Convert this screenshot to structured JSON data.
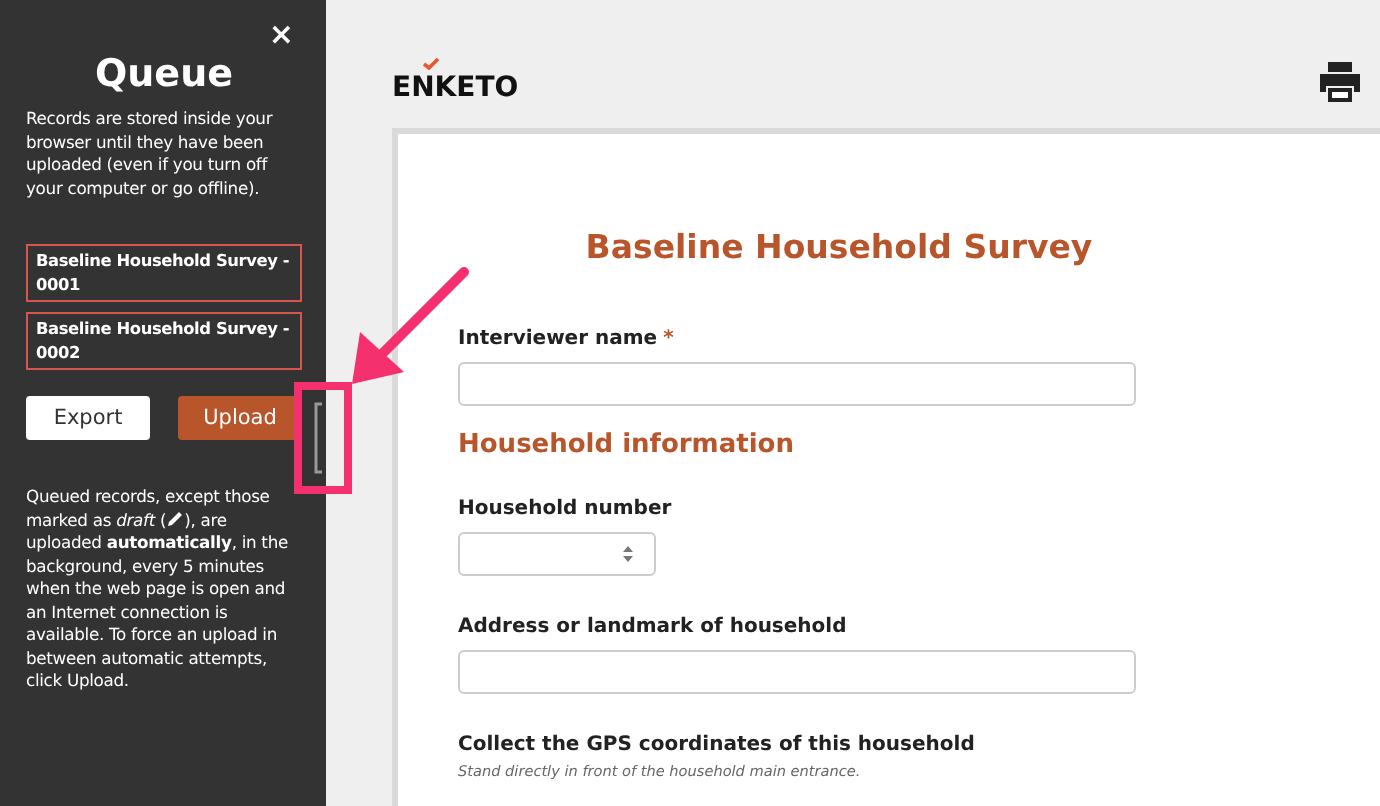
{
  "sidebar": {
    "close": "×",
    "title": "Queue",
    "intro": "Records are stored inside your browser until they have been uploaded (even if you turn off your computer or go offline).",
    "records": [
      "Baseline Household Survey - 0001",
      "Baseline Household Survey - 0002"
    ],
    "buttons": [
      {
        "label": "Export",
        "kind": "secondary"
      },
      {
        "label": "Upload",
        "kind": "primary"
      }
    ],
    "note": [
      "Queued records, except those marked as *draft* (",
      "), are uploaded **automatically**, in the background, every 5 minutes when the web page is open and an Internet connection is available. To force an upload in between automatic attempts, click Upload."
    ]
  },
  "header": {
    "logo": "ENKETO"
  },
  "form": {
    "title": "Baseline Household Survey",
    "required_mark": "*",
    "items": [
      {
        "kind": "text",
        "label": "Interviewer name",
        "required": true
      },
      {
        "kind": "section",
        "label": "Household information"
      },
      {
        "kind": "number",
        "label": "Household number",
        "required": false
      },
      {
        "kind": "text",
        "label": "Address or landmark of household",
        "required": false
      },
      {
        "kind": "geo",
        "label": "Collect the GPS coordinates of this household",
        "required": false,
        "hint": "Stand directly in front of the household main entrance."
      }
    ]
  }
}
